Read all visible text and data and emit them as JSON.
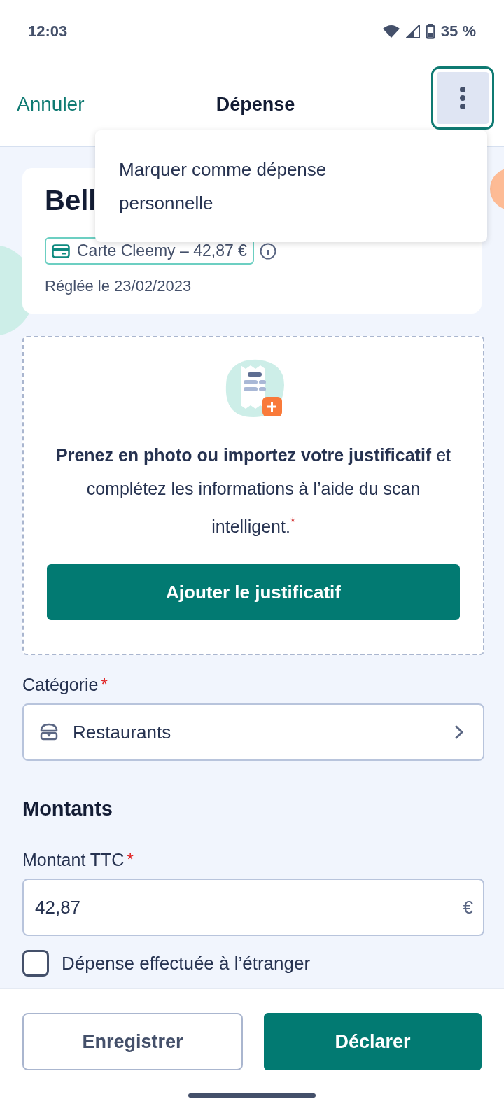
{
  "status_bar": {
    "time": "12:03",
    "battery": "35 %"
  },
  "header": {
    "cancel": "Annuler",
    "title": "Dépense",
    "menu_open": true,
    "menu_items": [
      "Marquer comme dépense personnelle"
    ]
  },
  "expense": {
    "merchant": "Bell",
    "payment": "Carte Cleemy – 42,87 €",
    "settled": "Réglée le 23/02/2023"
  },
  "receipt": {
    "text": "**Prenez en photo ou importez votre justificatif** et complétez les informations à l’aide du scan intelligent.$^{*}$",
    "button": "Ajouter le justificatif"
  },
  "category": {
    "label": "Catégorie",
    "required_mark": "*",
    "value": "Restaurants"
  },
  "amounts": {
    "heading": "Montants",
    "label": "Montant TTC",
    "required_mark": "*",
    "value": "42,87",
    "currency": "€"
  },
  "abroad": {
    "label": "Dépense effectuée à l’étranger",
    "checked": false
  },
  "buttons": {
    "save": "Enregistrer",
    "submit": "Déclarer"
  }
}
